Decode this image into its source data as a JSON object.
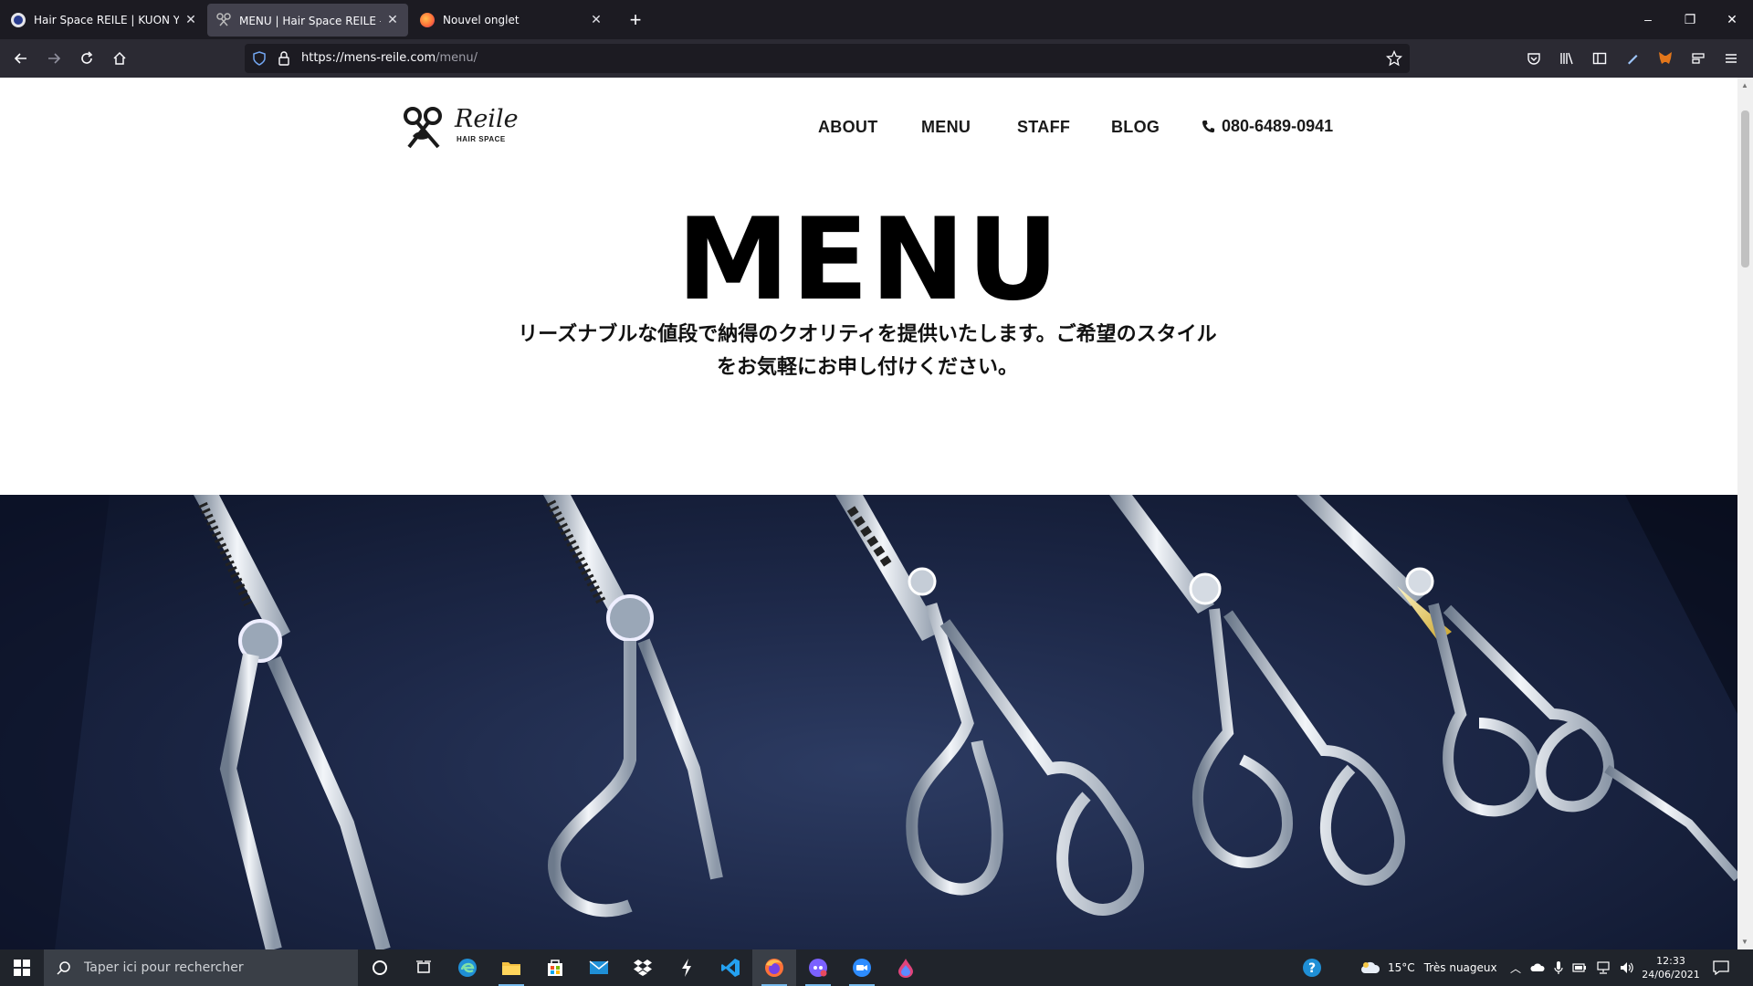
{
  "browser": {
    "tabs": [
      {
        "title": "Hair Space REILE | KUON YAGI P",
        "favicon_color": "#2a3d8f"
      },
      {
        "title": "MENU | Hair Space REILE - ヘア",
        "favicon_color": "#555555"
      },
      {
        "title": "Nouvel onglet",
        "favicon_color": "#ff7139"
      }
    ],
    "new_tab_label": "+",
    "url_base": "https://mens-reile.com",
    "url_path": "/menu/",
    "window_controls": {
      "minimize": "–",
      "restore": "❐",
      "close": "✕"
    }
  },
  "site": {
    "logo_text": "Reile",
    "logo_subtext": "HAIR SPACE",
    "nav": [
      "ABOUT",
      "MENU",
      "STAFF",
      "BLOG"
    ],
    "phone": "080-6489-0941",
    "title": "MENU",
    "subtitle_line1": "リーズナブルな値段で納得のクオリティを提供いたします。ご希望のスタイル",
    "subtitle_line2": "をお気軽にお申し付けください。"
  },
  "taskbar": {
    "search_placeholder": "Taper ici pour rechercher",
    "weather_temp": "15°C",
    "weather_text": "Très nuageux",
    "time": "12:33",
    "date": "24/06/2021",
    "accent_color": "#76b9ed"
  }
}
